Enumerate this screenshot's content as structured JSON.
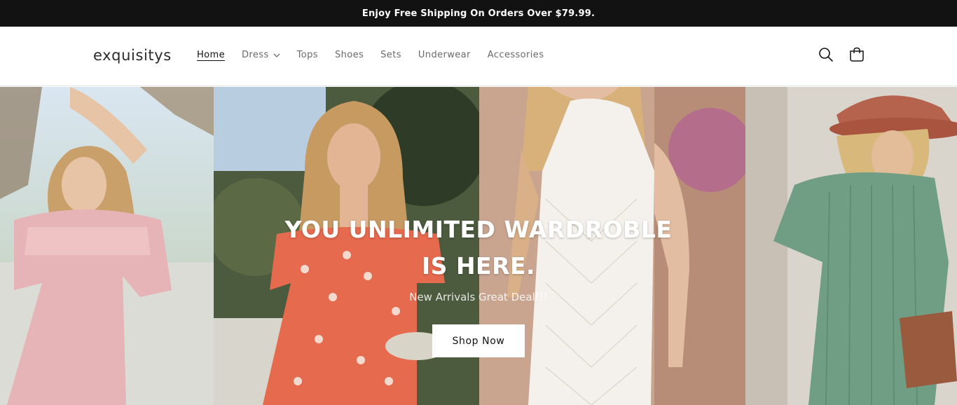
{
  "announcement": {
    "text": "Enjoy Free Shipping On Orders Over $79.99."
  },
  "header": {
    "logo": "exquisitys",
    "nav": [
      {
        "label": "Home",
        "active": true
      },
      {
        "label": "Dress",
        "has_dropdown": true
      },
      {
        "label": "Tops"
      },
      {
        "label": "Shoes"
      },
      {
        "label": "Sets"
      },
      {
        "label": "Underwear"
      },
      {
        "label": "Accessories"
      }
    ],
    "icons": [
      "search-icon",
      "cart-icon"
    ]
  },
  "hero": {
    "headline": "YOU UNLIMITED WARDROBLE IS HERE.",
    "subheadline": "New Arrivals Great Deal!!!",
    "cta_label": "Shop Now",
    "images": [
      "model-pink-dress",
      "model-floral-dress",
      "model-white-crochet-dress",
      "model-green-knit-dress"
    ]
  },
  "colors": {
    "announcement_bg": "#121212",
    "accent_text": "#121212",
    "nav_text": "#6a6a6a",
    "button_bg": "#ffffff"
  }
}
